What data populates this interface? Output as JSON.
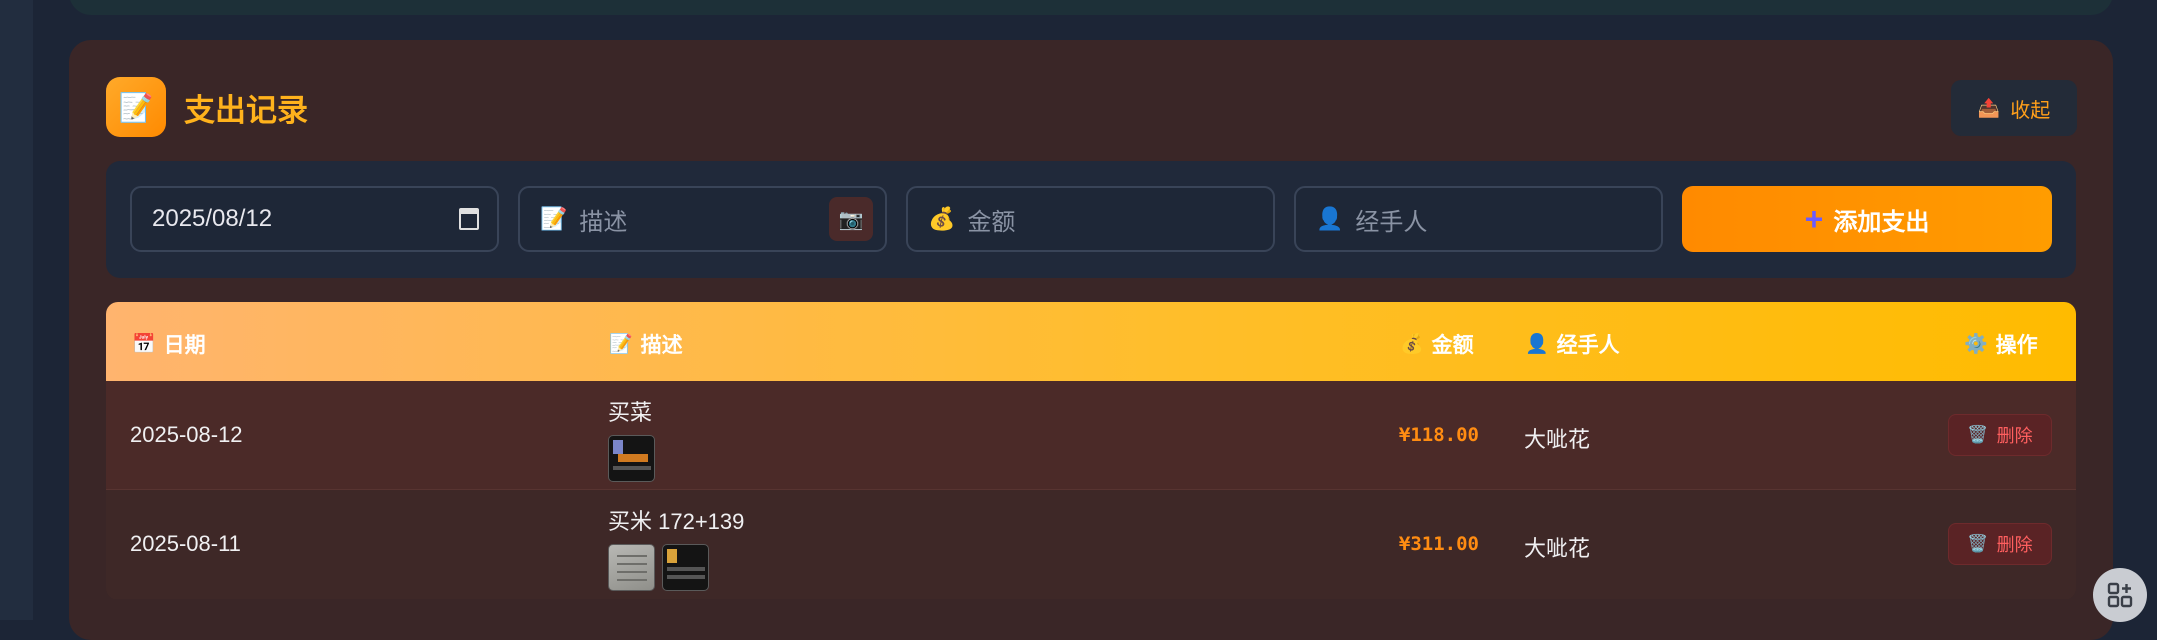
{
  "section": {
    "title": "支出记录",
    "logo_icon": "📝",
    "collapse_icon": "📤",
    "collapse_label": "收起"
  },
  "form": {
    "date_value": "2025/08/12",
    "description_icon": "📝",
    "description_placeholder": "描述",
    "camera_icon": "📷",
    "amount_icon": "💰",
    "amount_placeholder": "金额",
    "handler_icon": "👤",
    "handler_placeholder": "经手人",
    "add_icon": "➕",
    "add_label": "添加支出"
  },
  "table": {
    "headers": {
      "date": {
        "icon": "📅",
        "label": "日期"
      },
      "description": {
        "icon": "📝",
        "label": "描述"
      },
      "amount": {
        "icon": "💰",
        "label": "金额"
      },
      "handler": {
        "icon": "👤",
        "label": "经手人"
      },
      "actions": {
        "icon": "⚙️",
        "label": "操作"
      }
    },
    "rows": [
      {
        "date": "2025-08-12",
        "description": "买菜",
        "amount": "¥118.00",
        "handler": "大呲花",
        "delete_icon": "🗑️",
        "delete_label": "删除"
      },
      {
        "date": "2025-08-11",
        "description": "买米 172+139",
        "amount": "¥311.00",
        "handler": "大呲花",
        "delete_icon": "🗑️",
        "delete_label": "删除"
      }
    ]
  },
  "colors": {
    "accent": "#ff9500",
    "title": "#ffb21c",
    "amount": "#ff8c12",
    "delete": "#ff5f5f"
  },
  "fab_icon": "grid-plus-icon"
}
